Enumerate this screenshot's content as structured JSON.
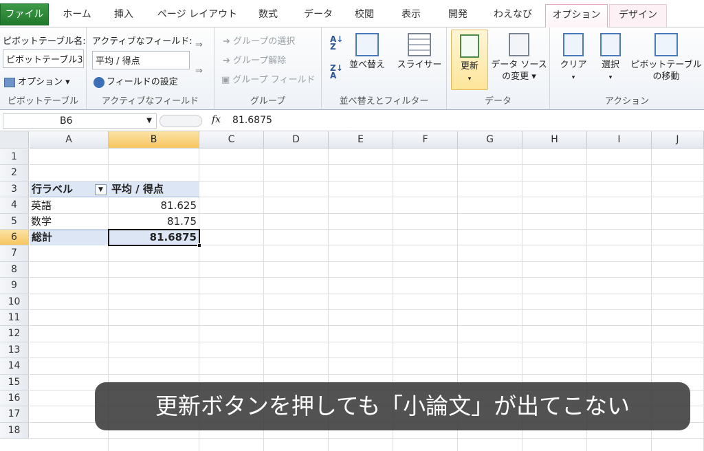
{
  "ribbon_tabs": [
    "ファイル",
    "ホーム",
    "挿入",
    "ページ レイアウト",
    "数式",
    "データ",
    "校閲",
    "表示",
    "開発",
    "わえなび",
    "オプション",
    "デザイン"
  ],
  "ribbon": {
    "pivot": {
      "name_label": "ピボットテーブル名:",
      "name_value": "ピボットテーブル3",
      "options_label": "オプション ▾",
      "group": "ピボットテーブル"
    },
    "active_field": {
      "label": "アクティブなフィールド:",
      "value": "平均 / 得点",
      "settings": "フィールドの設定",
      "group": "アクティブなフィールド"
    },
    "grouping": {
      "select": "グループの選択",
      "ungroup": "グループ解除",
      "group_field": "グループ フィールド",
      "group": "グループ"
    },
    "sort": {
      "sort_label": "並べ替え",
      "slicer": "スライサー",
      "group": "並べ替えとフィルター"
    },
    "data": {
      "refresh": "更新",
      "source_line1": "データ ソース",
      "source_line2": "の変更 ▾",
      "group": "データ"
    },
    "actions": {
      "clear": "クリア",
      "select": "選択",
      "move_line1": "ピボットテーブル",
      "move_line2": "の移動",
      "group": "アクション"
    }
  },
  "formula_bar": {
    "name_box": "B6",
    "fx": "fx",
    "value": "81.6875"
  },
  "columns": [
    "A",
    "B",
    "C",
    "D",
    "E",
    "F",
    "G",
    "H",
    "I",
    "J"
  ],
  "rows": [
    "1",
    "2",
    "3",
    "4",
    "5",
    "6",
    "7",
    "8",
    "9",
    "10",
    "11",
    "12",
    "13",
    "14",
    "15",
    "16",
    "17",
    "18"
  ],
  "pivot_table": {
    "header_label": "行ラベル",
    "header_value": "平均 / 得点",
    "rows": [
      {
        "label": "英語",
        "value": "81.625"
      },
      {
        "label": "数学",
        "value": "81.75"
      }
    ],
    "total_label": "総計",
    "total_value": "81.6875"
  },
  "caption": "更新ボタンを押しても「小論文」が出てこない",
  "colors": {
    "file_tab": "#2a8a37",
    "selection": "#f6c660",
    "total_row": "#dce6f4",
    "pivot_header": "#dce6f4"
  }
}
